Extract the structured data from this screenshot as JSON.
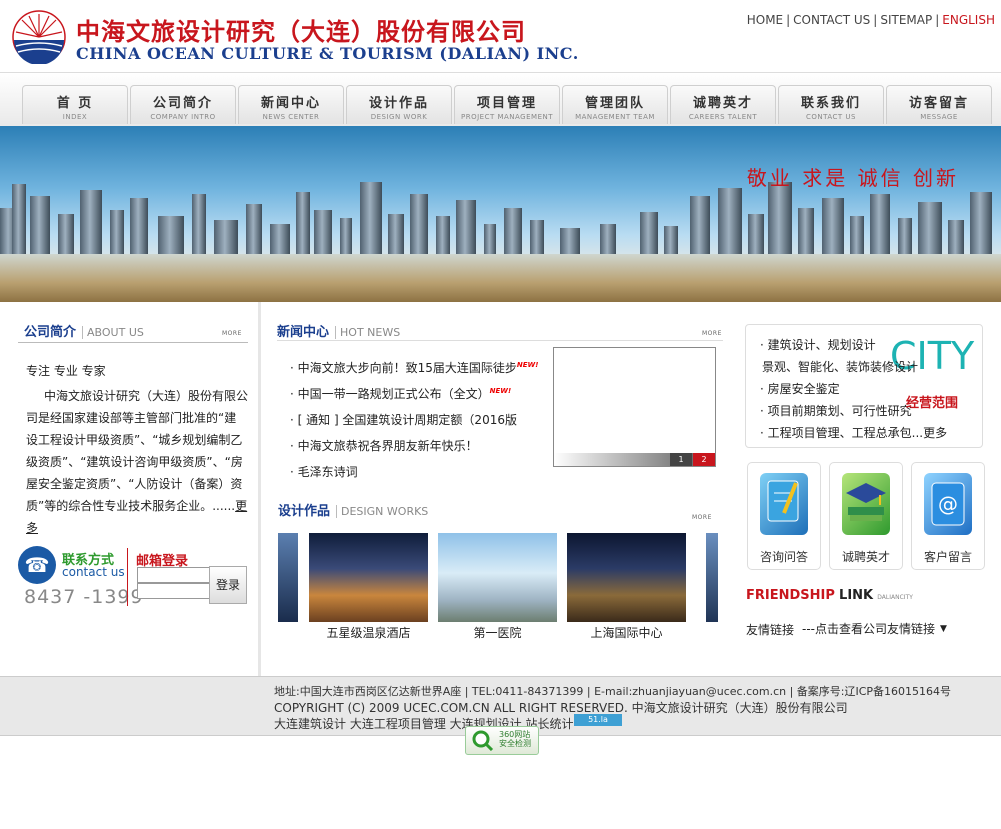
{
  "header": {
    "logo_cn": "中海文旅设计研究（大连）股份有限公司",
    "logo_en": "CHINA OCEAN CULTURE & TOURISM (DALIAN) INC.",
    "logo_ring_text": "EXPERT OFFICE",
    "top_links": [
      "HOME",
      "CONTACT US",
      "SITEMAP",
      "ENGLISH"
    ],
    "separator": "|"
  },
  "nav": [
    {
      "zh": "首  页",
      "en": "INDEX"
    },
    {
      "zh": "公司简介",
      "en": "COMPANY INTRO"
    },
    {
      "zh": "新闻中心",
      "en": "NEWS CENTER"
    },
    {
      "zh": "设计作品",
      "en": "DESIGN WORK"
    },
    {
      "zh": "项目管理",
      "en": "PROJECT MANAGEMENT"
    },
    {
      "zh": "管理团队",
      "en": "MANAGEMENT TEAM"
    },
    {
      "zh": "诚聘英才",
      "en": "CAREERS TALENT"
    },
    {
      "zh": "联系我们",
      "en": "CONTACT US"
    },
    {
      "zh": "访客留言",
      "en": "MESSAGE"
    }
  ],
  "banner": {
    "slogan": "敬业 求是 诚信 创新"
  },
  "about": {
    "title_zh": "公司简介",
    "title_en": "ABOUT US",
    "more": "MORE",
    "slogan": "专注 专业 专家",
    "text": "中海文旅设计研究（大连）股份有限公司是经国家建设部等主管部门批准的“建设工程设计甲级资质”、“城乡规划编制乙级资质”、“建筑设计咨询甲级资质”、“房屋安全鉴定资质”、“人防设计（备案）资质”等的综合性专业技术服务企业。......",
    "more_link": "更多"
  },
  "contact": {
    "icon": "phone-icon",
    "title_zh": "联系方式",
    "title_en": "contact us",
    "phone": "8437 -1399",
    "mail_title": "邮箱登录",
    "login_button": "登录"
  },
  "news": {
    "title_zh": "新闻中心",
    "title_en": "HOT NEWS",
    "more": "MORE",
    "items": [
      {
        "text": "· 中海文旅大步向前！致15届大连国际徒步",
        "badge": "NEW!"
      },
      {
        "text": "· 中国一带一路规划正式公布（全文）",
        "badge": "NEW!"
      },
      {
        "text": "· [ 通知 ] 全国建筑设计周期定额（2016版",
        "badge": ""
      },
      {
        "text": "· 中海文旅恭祝各界朋友新年快乐！",
        "badge": ""
      },
      {
        "text": "· 毛泽东诗词",
        "badge": ""
      }
    ],
    "slide_numbers": [
      "1",
      "2"
    ]
  },
  "works": {
    "title_zh": "设计作品",
    "title_en": "DESIGN WORKS",
    "more": "MORE",
    "items": [
      {
        "label": "五星级温泉酒店"
      },
      {
        "label": "第一医院"
      },
      {
        "label": "上海国际中心"
      }
    ]
  },
  "scope": {
    "items": [
      "· 建筑设计、规划设计",
      "景观、智能化、装饰装修设计",
      "· 房屋安全鉴定",
      "· 项目前期策划、可行性研究",
      "· 工程项目管理、工程总承包...更多"
    ],
    "city": "CITY",
    "label": "经营范围"
  },
  "tiles": [
    {
      "label": "咨询问答",
      "icon": "notebook-icon"
    },
    {
      "label": "诚聘英才",
      "icon": "graduation-cap-icon"
    },
    {
      "label": "客户留言",
      "icon": "email-book-icon"
    }
  ],
  "friendship": {
    "title_a": "FRIENDSHIP",
    "title_b": "LINK",
    "title_c": "DALIANCITY",
    "label": "友情链接",
    "select_value": "---点击查看公司友情链接"
  },
  "footer": {
    "address": "地址:中国大连市西岗区亿达新世界A座 | TEL:0411-84371399 | E-mail:zhuanjiayuan@ucec.com.cn | 备案序号:辽ICP备16015164号",
    "copyright": "COPYRIGHT (C) 2009 UCEC.COM.CN ALL RIGHT RESERVED. 中海文旅设计研究（大连）股份有限公司",
    "links": "大连建筑设计 大连工程项目管理 大连规划设计 站长统计",
    "stat_badge": "51.la",
    "safe_badge": "360网站 安全检测"
  },
  "colors": {
    "brand_red": "#c8161d",
    "brand_blue": "#1b3f8e",
    "accent_teal": "#1db3b3"
  }
}
